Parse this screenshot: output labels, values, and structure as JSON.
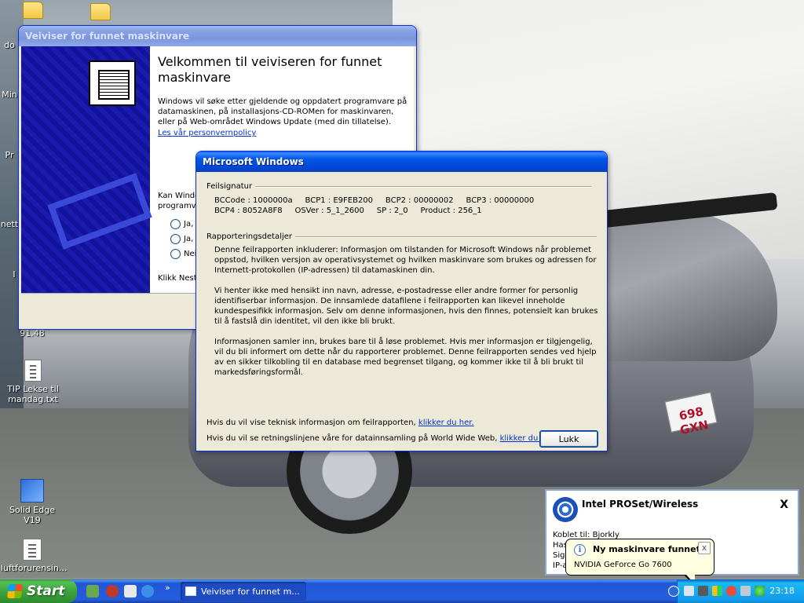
{
  "desktop": {
    "icons": [
      {
        "label": "TIP Lekse til mandag.txt",
        "type": "text-file-icon"
      },
      {
        "label": "Solid Edge V19",
        "type": "shortcut-icon"
      },
      {
        "label": "luftforurensin...",
        "type": "document-icon"
      }
    ],
    "partial_labels": [
      "do",
      "Min",
      "Pr",
      "nett",
      "I",
      "91.48"
    ],
    "license_plate": "698 GXN"
  },
  "wizard": {
    "title": "Veiviser for funnet maskinvare",
    "heading": "Velkommen til veiviseren for funnet maskinvare",
    "intro": "Windows vil søke etter gjeldende og oppdatert programvare på datamaskinen, på installasjons-CD-ROMen for maskinvaren, eller på Web-området Windows Update (med din tillatelse).",
    "privacy_link": "Les vår personvernpolicy",
    "question_partial": "Kan Windo\nprogramva",
    "options": [
      "Ja, n",
      "Ja, n",
      "Nei,"
    ],
    "bottom_partial": "Klikk Neste"
  },
  "error_dialog": {
    "title": "Microsoft Windows",
    "signature_header": "Feilsignatur",
    "signature_line1": "BCCode : 1000000a     BCP1 : E9FEB200     BCP2 : 00000002     BCP3 : 00000000",
    "signature_line2": "BCP4 : 8052A8F8     OSVer : 5_1_2600     SP : 2_0     Product : 256_1",
    "details_header": "Rapporteringsdetaljer",
    "para1": "Denne feilrapporten inkluderer: Informasjon om tilstanden for Microsoft Windows når problemet oppstod, hvilken versjon av operativsystemet og hvilken maskinvare som brukes og adressen for Internett-protokollen (IP-adressen) til datamaskinen din.",
    "para2": "Vi henter ikke med hensikt inn navn, adresse, e-postadresse eller andre former for personlig identifiserbar informasjon. De innsamlede datafilene i feilrapporten kan likevel inneholde kundespesifikk informasjon. Selv om denne informasjonen, hvis den finnes, potensielt kan brukes til å fastslå din identitet, vil den ikke bli brukt.",
    "para3": "Informasjonen samler inn, brukes bare til å løse problemet. Hvis mer informasjon er tilgjengelig, vil du bli informert om dette når du rapporterer problemet. Denne feilrapporten sendes ved hjelp av en sikker tilkobling til en database med begrenset tilgang, og kommer ikke til å bli brukt til markedsføringsformål.",
    "tech_text": "Hvis du vil vise teknisk informasjon om feilrapporten, ",
    "tech_link": "klikker du her.",
    "policy_text": "Hvis du vil se retningslinjene våre for datainnsamling på World Wide Web, ",
    "policy_link": "klikker du her.",
    "close_button": "Lukk"
  },
  "intel": {
    "title": "Intel PROSet/Wireless",
    "close": "X",
    "lines": [
      "Koblet til: Bjorkly",
      "Has",
      "Sign",
      "IP-a"
    ]
  },
  "balloon": {
    "title": "Ny maskinvare funnet",
    "body": "NVIDIA GeForce Go 7600",
    "close": "x"
  },
  "taskbar": {
    "start_label": "Start",
    "task_label": "Veiviser for funnet m...",
    "overflow": "»",
    "clock": "23:18"
  }
}
